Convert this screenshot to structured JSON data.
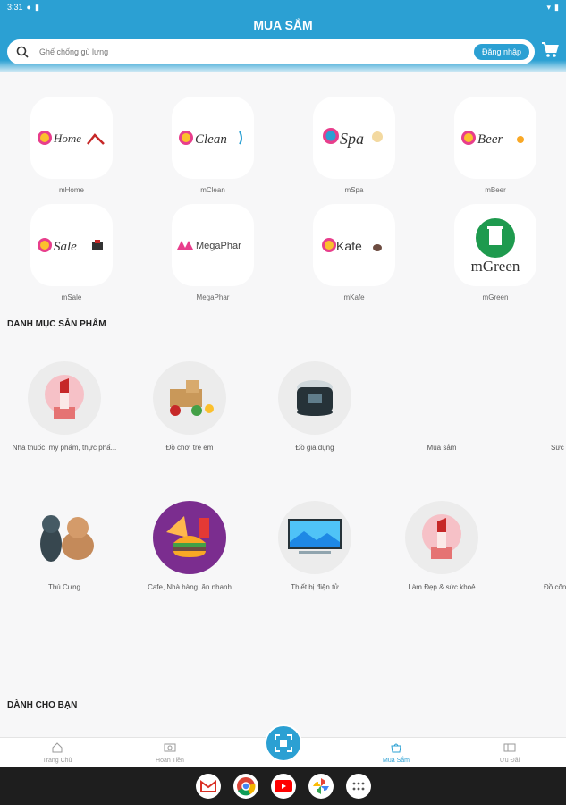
{
  "status": {
    "time": "3:31"
  },
  "header": {
    "title": "MUA SẮM"
  },
  "search": {
    "placeholder": "Ghế chống gù lưng",
    "login_label": "Đăng nhập"
  },
  "brands": [
    {
      "label": "mHome",
      "logo_text": "Home"
    },
    {
      "label": "mClean",
      "logo_text": "Clean"
    },
    {
      "label": "mSpa",
      "logo_text": "Spa"
    },
    {
      "label": "mBeer",
      "logo_text": "Beer"
    },
    {
      "label": "mSale",
      "logo_text": "Sale"
    },
    {
      "label": "MegaPhar",
      "logo_text": "MegaPhar"
    },
    {
      "label": "mKafe",
      "logo_text": "Kafe"
    },
    {
      "label": "mGreen",
      "logo_text": "mGreen"
    }
  ],
  "sections": {
    "categories": "DANH MỤC SẢN PHẨM",
    "for_you": "DÀNH CHO BẠN"
  },
  "categories_row1": [
    {
      "label": "Nhà thuốc, mỹ phẩm, thực phẩ..."
    },
    {
      "label": "Đồ chơi trẻ em"
    },
    {
      "label": "Đồ gia dụng"
    },
    {
      "label": "Mua sắm"
    },
    {
      "label": "Sức"
    }
  ],
  "categories_row2": [
    {
      "label": "Thú Cưng"
    },
    {
      "label": "Cafe, Nhà hàng, ăn nhanh"
    },
    {
      "label": "Thiết bị điện tử"
    },
    {
      "label": "Làm Đẹp & sức khoẻ"
    },
    {
      "label": "Đồ côn"
    }
  ],
  "nav": [
    {
      "label": "Trang Chủ"
    },
    {
      "label": "Hoàn Tiền"
    },
    {
      "label": "Mua Sắm"
    },
    {
      "label": "Ưu Đãi"
    }
  ],
  "colors": {
    "primary": "#2ba0d3",
    "background": "#f7f7f8"
  }
}
